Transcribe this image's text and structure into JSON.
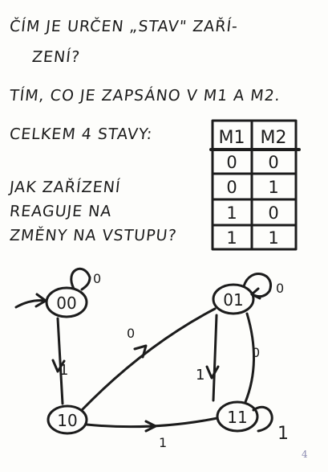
{
  "notes": {
    "line1": "ČÍM JE URČEN „STAV\" ZAŘÍ-",
    "line2": "ZENÍ?",
    "line3": "TÍM, CO JE ZAPSÁNO V M1 A M2.",
    "line4": "CELKEM 4 STAVY:",
    "line5": "JAK ZAŘÍZENÍ",
    "line6": "REAGUJE NA",
    "line7": "ZMĚNY NA VSTUPU?"
  },
  "table": {
    "headers": [
      "M1",
      "M2"
    ],
    "rows": [
      [
        "0",
        "0"
      ],
      [
        "0",
        "1"
      ],
      [
        "1",
        "0"
      ],
      [
        "1",
        "1"
      ]
    ]
  },
  "diagram": {
    "states": {
      "s00": "00",
      "s01": "01",
      "s10": "10",
      "s11": "11"
    },
    "transitions": {
      "loop00": "0",
      "loop01": "0",
      "loop11": "1",
      "t00_10": "1",
      "t10_01": "0",
      "t10_11": "1",
      "t01_11": "1",
      "t11_01": "0"
    }
  },
  "page_number": "4"
}
